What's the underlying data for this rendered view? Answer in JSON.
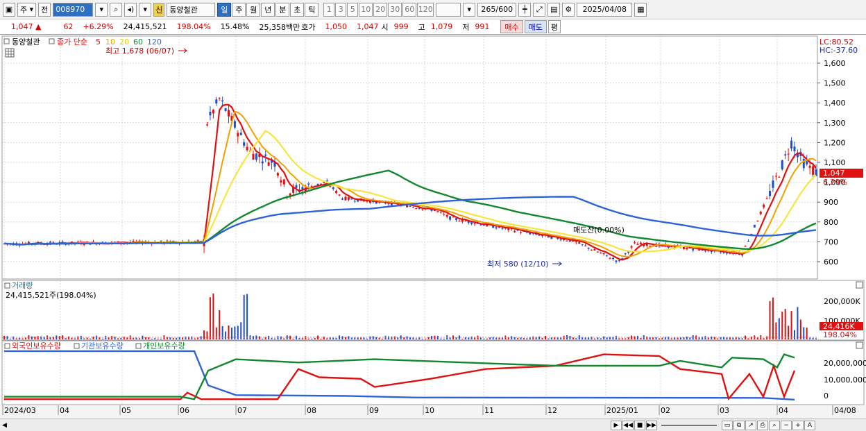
{
  "toolbar": {
    "market": "주",
    "scope": "전",
    "code": "008970",
    "badge": "신",
    "name": "동양철관",
    "periods": [
      "일",
      "주",
      "월",
      "년",
      "분",
      "초",
      "틱"
    ],
    "active_period": "일",
    "intervals": [
      "1",
      "3",
      "5",
      "10",
      "20",
      "30",
      "60",
      "120"
    ],
    "count": "265",
    "count_total": "/600",
    "date": "2025/04/08"
  },
  "quote": {
    "price": "1,047 ▲",
    "change": "62",
    "change_pct": "+6.29%",
    "volume": "24,415,521",
    "volume_ratio": "198.04%",
    "turnover": "15.48%",
    "amount": "25,358백만",
    "hoga_label": "호가",
    "ask": "1,050",
    "bid": "1,047",
    "open_label": "시",
    "open": "999",
    "high_label": "고",
    "high": "1,079",
    "low_label": "저",
    "low": "991",
    "buy": "매수",
    "sell": "매도",
    "avg": "평"
  },
  "price_panel": {
    "title": "동양철관",
    "legend_main": "종가 단순",
    "ma": [
      {
        "label": "5",
        "color": "#e01010"
      },
      {
        "label": "10",
        "color": "#f0a000"
      },
      {
        "label": "20",
        "color": "#e0d000"
      },
      {
        "label": "60",
        "color": "#13872f"
      },
      {
        "label": "120",
        "color": "#2e63d8"
      }
    ],
    "lc": "LC:80.52",
    "hc": "HC:-37.60",
    "high_note": "최고 1,678 (06/07)",
    "low_note": "최저 580 (12/10)",
    "sell_note": "매도잔(0.00%)",
    "current_price": "1,047",
    "current_pct": "6.29%",
    "y_labels": [
      "1,600",
      "1,500",
      "1,400",
      "1,300",
      "1,200",
      "1,100",
      "1,000",
      "900",
      "800",
      "700",
      "600"
    ]
  },
  "volume_panel": {
    "title": "거래량",
    "value": "24,415,521주(198.04%)",
    "y_labels": [
      "200,000K",
      "100,000K"
    ],
    "current": "24,416K",
    "current_pct": "198.04%"
  },
  "holding_panel": {
    "legend": [
      "외국인보유수량",
      "기관보유수량",
      "개인보유수량"
    ],
    "colors": [
      "#e01010",
      "#2e63d8",
      "#13872f"
    ],
    "y_labels": [
      "20,000,000",
      "10,000,000",
      "0"
    ]
  },
  "x_axis": [
    "2024/03",
    "04",
    "05",
    "06",
    "07",
    "08",
    "09",
    "10",
    "11",
    "12",
    "2025/01",
    "02",
    "03",
    "04",
    "04/08"
  ],
  "colors": {
    "up": "#e01010",
    "down": "#1f4fd0",
    "accent": "#2d6fc0"
  }
}
